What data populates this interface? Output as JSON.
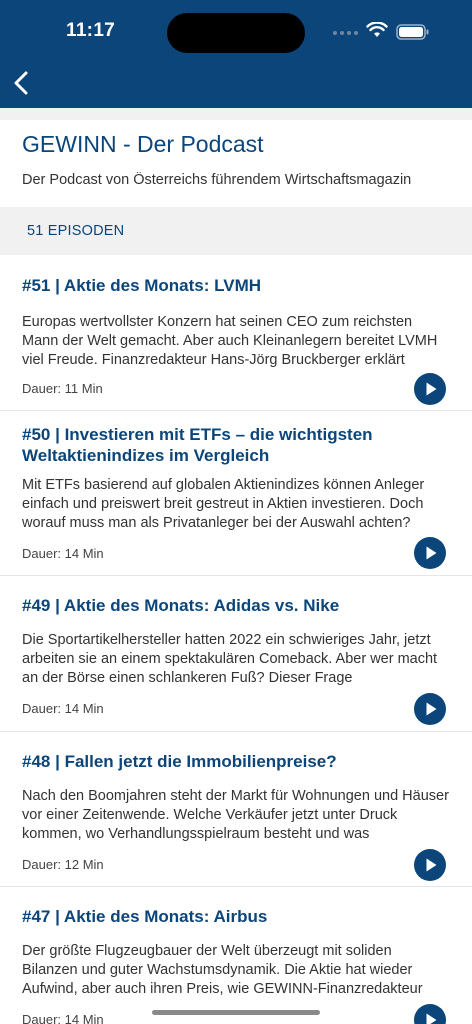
{
  "status_bar": {
    "time": "11:17"
  },
  "podcast": {
    "title": "GEWINN - Der Podcast",
    "description": "Der Podcast von Österreichs führendem Wirtschaftsmagazin",
    "episode_count_label": "51 EPISODEN"
  },
  "episodes": [
    {
      "title": "#51 | Aktie des Monats: LVMH",
      "description": "Europas wertvollster Konzern hat seinen CEO zum reichsten Mann der Welt gemacht. Aber auch Kleinanlegern bereitet LVMH viel Freude. Finanzredakteur Hans-Jörg Bruckberger erklärt",
      "duration": "Dauer: 11 Min"
    },
    {
      "title": "#50 | Investieren mit ETFs – die wichtigsten Weltaktienindizes im Vergleich",
      "description": "Mit ETFs basierend auf globalen Aktienindizes können Anleger einfach und preiswert breit gestreut in Aktien investieren. Doch worauf muss man als Privatanleger bei der Auswahl achten?",
      "duration": "Dauer: 14 Min"
    },
    {
      "title": "#49 | Aktie des Monats: Adidas vs. Nike",
      "description": "Die Sportartikelhersteller hatten 2022 ein schwieriges Jahr, jetzt arbeiten sie an einem spektakulären Comeback. Aber wer macht an der Börse einen schlankeren Fuß? Dieser Frage",
      "duration": "Dauer: 14 Min"
    },
    {
      "title": "#48 | Fallen jetzt die Immobilienpreise?",
      "description": "Nach den Boomjahren steht der Markt für Wohnungen und Häuser vor einer Zeitenwende. Welche Verkäufer jetzt unter Druck kommen, wo Verhandlungsspielraum besteht und was",
      "duration": "Dauer: 12 Min"
    },
    {
      "title": "#47 | Aktie des Monats: Airbus",
      "description": "Der größte Flugzeugbauer der Welt überzeugt mit soliden Bilanzen und guter Wachstumsdynamik. Die Aktie hat wieder Aufwind, aber auch ihren Preis, wie GEWINN-Finanzredakteur",
      "duration": "Dauer: 14 Min"
    }
  ],
  "colors": {
    "brand": "#0b457a",
    "section_bg": "#f1f1f1"
  }
}
